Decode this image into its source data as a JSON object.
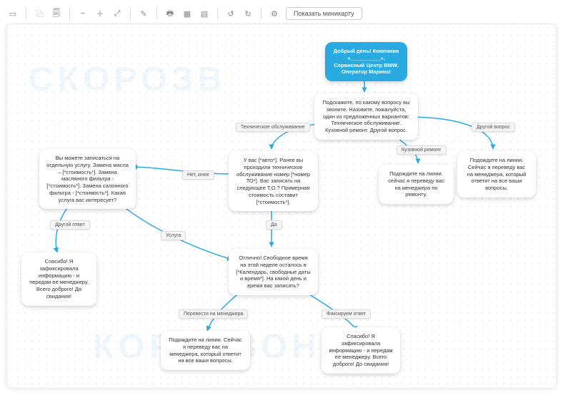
{
  "toolbar": {
    "minimap_label": "Показать миникарту",
    "icons": [
      "◻",
      "🗐",
      "🖺",
      "⌕-",
      "⌕+",
      "⤢",
      "✎",
      "🖶",
      "⬚",
      "⬚",
      "↺",
      "↻",
      "⎃"
    ]
  },
  "nodes": {
    "root": "Добрый день! Компания «__________». Сервисный Центр BMW. Оператор Марина!",
    "question": "Подскажите, по какому вопросу вы звоните. Назовите, пожалуйста, один из предложенных вариантов: Техническое обслуживание. Кузовной ремонт. Другой вопрос.",
    "other_q": "Подождите на линии. Сейчас я переведу вас на менеджера, который ответит на все ваши вопросы.",
    "body_repair": "Подождите на линии. сейчас я переведу вас на менеджера по ремонту.",
    "to": "У вас [*авто*]. Ранее вы проходили техническое обслуживание номер [*номер ТО*]. Вас записать на следующее Т.О.? Примерная стоимость составит [*стоимость*].",
    "services": "Вы можете записаться на отдельную услугу. Замена масла – [*стоимость*]. Замена масляного фильтра - [*стоимость*]. Замена салонного фильтра - [*стоимость*]. Какая услуга вас интересует?",
    "thanks": "Спасибо! Я зафиксировала информацию  - и передам ее менеджеру. Всего доброго! До свидания!",
    "schedule": "Отлично! Свободное время на этой неделе осталось в [*Календарь, свободные даты и время*]. На какой день и время вас записать?",
    "to_manager": "Подождите на линии. Сейчас я переведу вас на менеджера, который ответит на все ваши вопросы.",
    "thanks2": "Спасибо! Я зафиксировала информацию  - и передам ее менеджеру. Всего доброго! До свидания!"
  },
  "labels": {
    "tech": "Техническое обслуживание",
    "body": "Кузовной ремонт",
    "other": "Другой вопрос",
    "no_other": "Нет, иное",
    "yes": "Да",
    "service": "Услуга",
    "other_ans": "Другой ответ",
    "to_mgr": "Перевести на менеджера",
    "fix_ans": "Фиксируем ответ"
  }
}
